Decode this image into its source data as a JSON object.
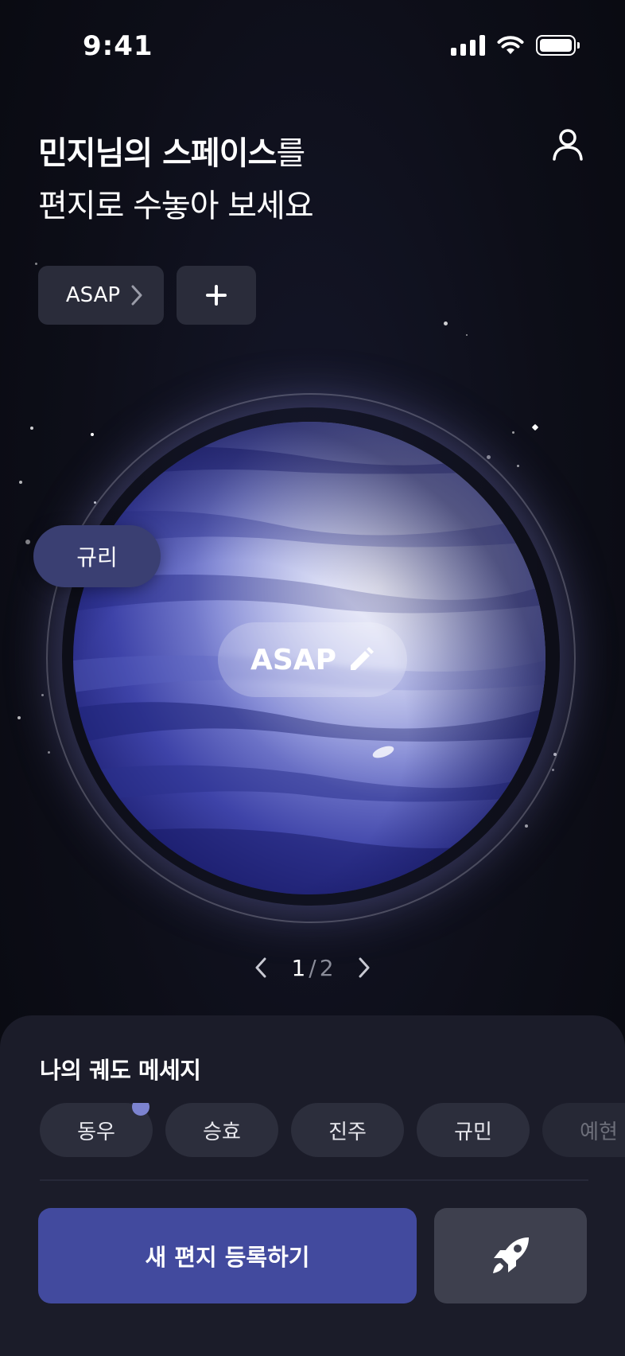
{
  "status_bar": {
    "time": "9:41"
  },
  "header": {
    "title_bold": "민지님의 스페이스",
    "title_suffix": "를",
    "subtitle": "편지로 수놓아 보세요"
  },
  "space_chip": {
    "label": "ASAP"
  },
  "planet": {
    "label": "ASAP"
  },
  "orbiting_friend": {
    "name": "규리"
  },
  "pager": {
    "current": "1",
    "separator": "/",
    "total": "2"
  },
  "sheet": {
    "title": "나의 궤도 메세지",
    "friends": [
      {
        "name": "동우",
        "has_new": true
      },
      {
        "name": "승효",
        "has_new": false
      },
      {
        "name": "진주",
        "has_new": false
      },
      {
        "name": "규민",
        "has_new": false
      },
      {
        "name": "예현",
        "has_new": false
      }
    ],
    "primary_button": "새 편지 등록하기"
  },
  "icons": {
    "profile": "person-icon",
    "chip_arrow": "chevron-right-icon",
    "add": "plus-icon",
    "edit": "pencil-icon",
    "prev": "chevron-left-icon",
    "next": "chevron-right-icon",
    "rocket": "rocket-icon"
  },
  "colors": {
    "background": "#0b0c13",
    "chip": "#2a2c3a",
    "primary": "#424a9e",
    "friend_pill": "#3a3f72",
    "sheet": "#1b1c29"
  }
}
